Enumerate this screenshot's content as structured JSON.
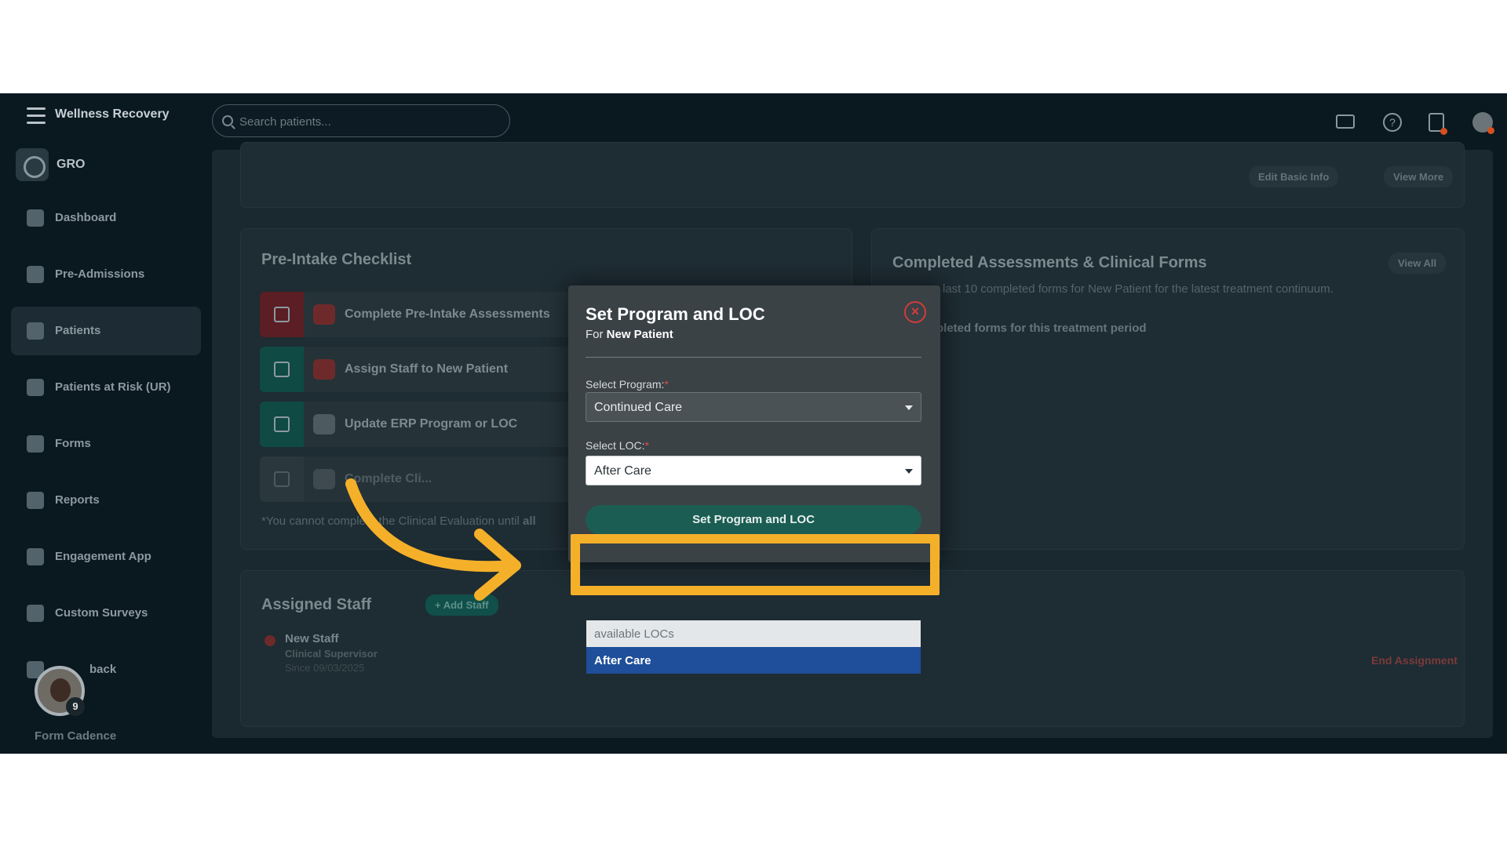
{
  "app": {
    "brand": "Wellness Recovery",
    "org": "GRO"
  },
  "search": {
    "placeholder": "Search patients..."
  },
  "sidebar": {
    "items": [
      {
        "label": "Dashboard",
        "icon": "dashboard-icon"
      },
      {
        "label": "Pre-Admissions",
        "icon": "building-icon"
      },
      {
        "label": "Patients",
        "icon": "users-icon"
      },
      {
        "label": "Patients at Risk (UR)",
        "icon": "flag-icon"
      },
      {
        "label": "Forms",
        "icon": "edit-icon"
      },
      {
        "label": "Reports",
        "icon": "pie-chart-icon"
      },
      {
        "label": "Engagement App",
        "icon": "sprout-icon"
      },
      {
        "label": "Custom Surveys",
        "icon": "survey-icon"
      },
      {
        "label": "back",
        "icon": "feedback-icon"
      }
    ],
    "avatar_badge": "9",
    "footer": "Form Cadence"
  },
  "header_card": {
    "edit_label": "Edit Basic Info",
    "view_more_label": "View More"
  },
  "checklist": {
    "title": "Pre-Intake Checklist",
    "items": [
      {
        "label": "Complete Pre-Intake Assessments"
      },
      {
        "label": "Assign Staff to New Patient"
      },
      {
        "label": "Update ERP Program or LOC"
      },
      {
        "label": "Complete Cli..."
      }
    ],
    "note_start": "*You cannot complete the Clinical Evaluation until",
    "note_bold": "all"
  },
  "completed": {
    "title": "Completed Assessments & Clinical Forms",
    "view_all": "View All",
    "subtitle": "last 10 completed forms for New Patient for the latest treatment continuum.",
    "empty": "pleted forms for this treatment period"
  },
  "assigned": {
    "title": "Assigned Staff",
    "add_label": "+ Add Staff",
    "staff_name": "New Staff",
    "staff_role": "Clinical Supervisor",
    "staff_since": "Since 09/03/2025",
    "end_label": "End Assignment"
  },
  "modal": {
    "title": "Set Program and LOC",
    "for_prefix": "For",
    "for_name": "New Patient",
    "program_label": "Select Program:",
    "program_value": "Continued Care",
    "loc_label": "Select LOC:",
    "loc_value": "After Care",
    "submit_label": "Set Program and LOC",
    "close_symbol": "×"
  },
  "dropdown": {
    "header": "available LOCs",
    "selected": "After Care"
  },
  "colors": {
    "highlight": "#f5b02a",
    "accent": "#1b5d53",
    "danger": "#d23b3b",
    "selected": "#1f4f9a"
  }
}
